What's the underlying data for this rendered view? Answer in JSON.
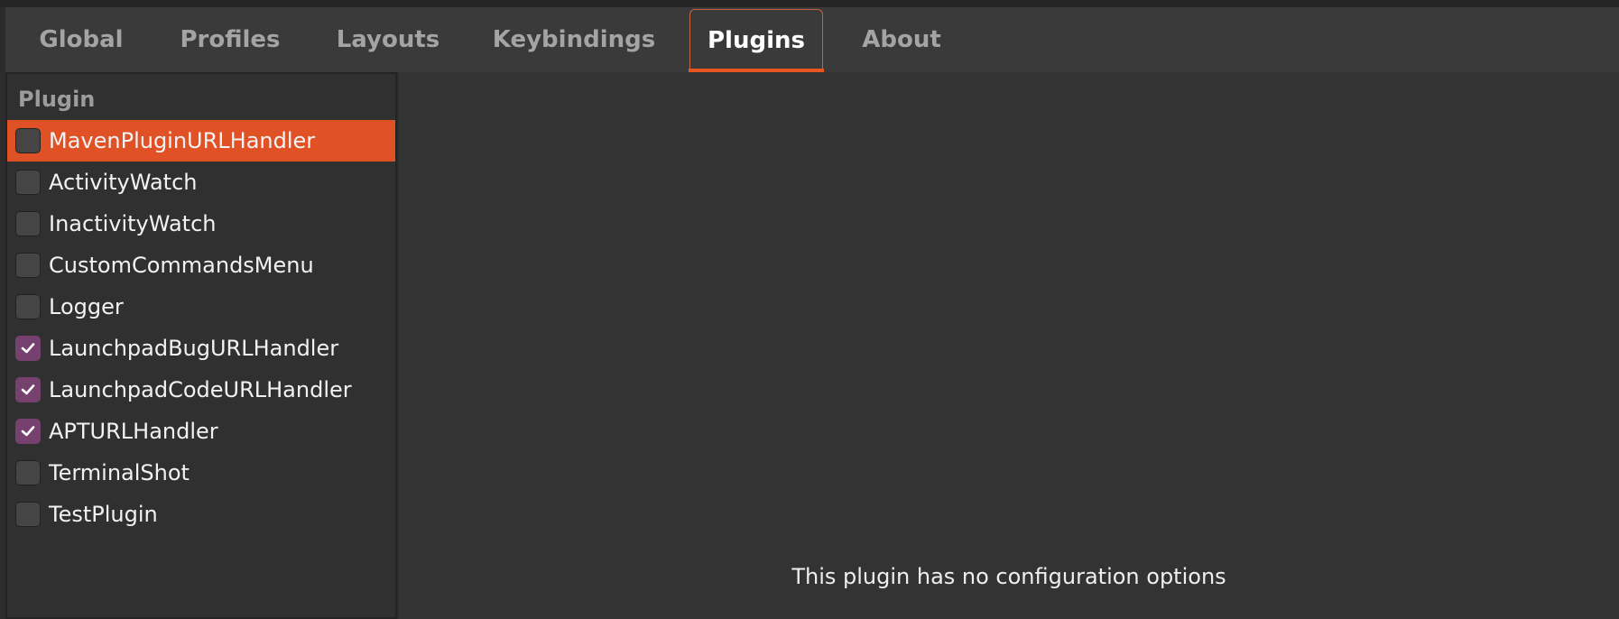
{
  "tabs": [
    {
      "label": "Global",
      "active": false
    },
    {
      "label": "Profiles",
      "active": false
    },
    {
      "label": "Layouts",
      "active": false
    },
    {
      "label": "Keybindings",
      "active": false
    },
    {
      "label": "Plugins",
      "active": true
    },
    {
      "label": "About",
      "active": false
    }
  ],
  "plugin_list": {
    "column_header": "Plugin",
    "items": [
      {
        "label": "MavenPluginURLHandler",
        "checked": false,
        "selected": true
      },
      {
        "label": "ActivityWatch",
        "checked": false,
        "selected": false
      },
      {
        "label": "InactivityWatch",
        "checked": false,
        "selected": false
      },
      {
        "label": "CustomCommandsMenu",
        "checked": false,
        "selected": false
      },
      {
        "label": "Logger",
        "checked": false,
        "selected": false
      },
      {
        "label": "LaunchpadBugURLHandler",
        "checked": true,
        "selected": false
      },
      {
        "label": "LaunchpadCodeURLHandler",
        "checked": true,
        "selected": false
      },
      {
        "label": "APTURLHandler",
        "checked": true,
        "selected": false
      },
      {
        "label": "TerminalShot",
        "checked": false,
        "selected": false
      },
      {
        "label": "TestPlugin",
        "checked": false,
        "selected": false
      }
    ]
  },
  "config_panel": {
    "message": "This plugin has no configuration options"
  },
  "colors": {
    "accent": "#e95420",
    "selected_row": "#e05126",
    "checkbox_checked": "#77416f"
  }
}
